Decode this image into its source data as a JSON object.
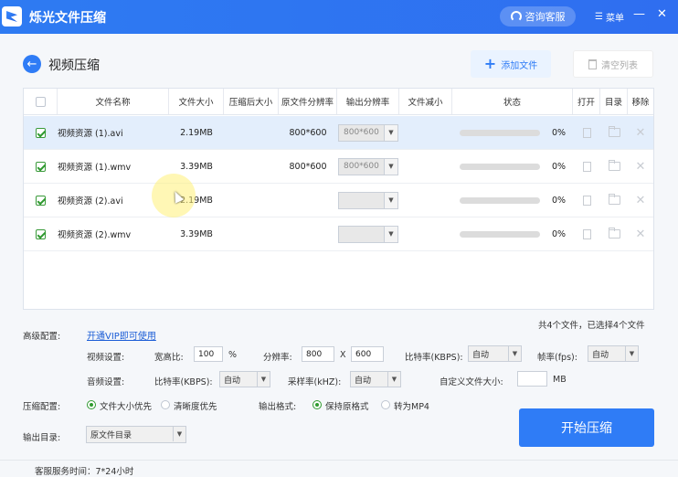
{
  "app": {
    "title": "烁光文件压缩",
    "service_label": "咨询客服",
    "menu_label": "菜单",
    "minimize": "—",
    "close": "✕"
  },
  "header": {
    "back": "←",
    "title": "视频压缩",
    "add_file": "添加文件",
    "clear_list": "清空列表"
  },
  "table": {
    "columns": [
      "文件名称",
      "文件大小",
      "压缩后大小",
      "原文件分辨率",
      "输出分辨率",
      "文件减小",
      "状态",
      "打开",
      "目录",
      "移除"
    ],
    "rows": [
      {
        "selected": true,
        "checked": true,
        "name": "视频资源 (1).avi",
        "size": "2.19MB",
        "compressed": "",
        "source_res": "800*600",
        "output_res": "800*600",
        "reduced": "",
        "progress": 0,
        "status": "0%"
      },
      {
        "selected": false,
        "checked": true,
        "name": "视频资源 (1).wmv",
        "size": "3.39MB",
        "compressed": "",
        "source_res": "800*600",
        "output_res": "800*600",
        "reduced": "",
        "progress": 0,
        "status": "0%"
      },
      {
        "selected": false,
        "checked": true,
        "name": "视频资源 (2).avi",
        "size": "2.19MB",
        "compressed": "",
        "source_res": "",
        "output_res": "",
        "reduced": "",
        "progress": 0,
        "status": "0%"
      },
      {
        "selected": false,
        "checked": true,
        "name": "视频资源 (2).wmv",
        "size": "3.39MB",
        "compressed": "",
        "source_res": "",
        "output_res": "",
        "reduced": "",
        "progress": 0,
        "status": "0%"
      }
    ],
    "summary": "共4个文件，已选择4个文件"
  },
  "settings": {
    "advanced_label": "高级配置:",
    "vip_link": "开通VIP即可使用",
    "video_label": "视频设置:",
    "aspect_label": "宽高比:",
    "aspect_value": "100",
    "aspect_unit": "%",
    "resolution_label": "分辨率:",
    "res_w": "800",
    "res_x": "X",
    "res_h": "600",
    "bitrate_label": "比特率(KBPS):",
    "bitrate_value": "自动",
    "fps_label": "帧率(fps):",
    "fps_value": "自动",
    "audio_label": "音频设置:",
    "audio_bitrate_label": "比特率(KBPS):",
    "audio_bitrate_value": "自动",
    "sample_label": "采样率(kHZ):",
    "sample_value": "自动",
    "custom_size_label": "自定义文件大小:",
    "custom_size_value": "",
    "custom_size_unit": "MB",
    "compress_label": "压缩配置:",
    "opt_size_first": "文件大小优先",
    "opt_clarity_first": "清晰度优先",
    "format_label": "输出格式:",
    "opt_keep_format": "保持原格式",
    "opt_to_mp4": "转为MP4",
    "output_dir_label": "输出目录:",
    "output_dir_value": "原文件目录"
  },
  "actions": {
    "start": "开始压缩"
  },
  "footer": {
    "service_hours": "客服服务时间：7*24小时"
  },
  "colors": {
    "primary": "#2f7cf6",
    "check": "#2f9a2f",
    "selected_row": "#e3eefc"
  }
}
